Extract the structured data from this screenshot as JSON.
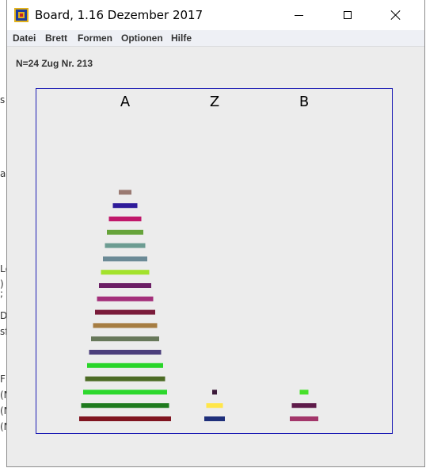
{
  "window": {
    "title": "Board, 1.16 Dezember 2017"
  },
  "menu": [
    "Datei",
    "Brett",
    "Formen",
    "Optionen",
    "Hilfe"
  ],
  "status": "N=24 Zug Nr. 213",
  "board": {
    "pegs": [
      {
        "label": "A",
        "disks": [
          {
            "size": 24,
            "color": "#801520"
          },
          {
            "size": 23,
            "color": "#1e7a1e"
          },
          {
            "size": 22,
            "color": "#2dd82d"
          },
          {
            "size": 21,
            "color": "#4c6b25"
          },
          {
            "size": 20,
            "color": "#29d529"
          },
          {
            "size": 19,
            "color": "#4c3f7c"
          },
          {
            "size": 18,
            "color": "#67785a"
          },
          {
            "size": 17,
            "color": "#a67d42"
          },
          {
            "size": 16,
            "color": "#7a1b3a"
          },
          {
            "size": 15,
            "color": "#a32f7a"
          },
          {
            "size": 14,
            "color": "#6b1e64"
          },
          {
            "size": 13,
            "color": "#a3e22c"
          },
          {
            "size": 12,
            "color": "#6b8a96"
          },
          {
            "size": 11,
            "color": "#6c9c92"
          },
          {
            "size": 10,
            "color": "#66a33a"
          },
          {
            "size": 9,
            "color": "#c0186a"
          },
          {
            "size": 7,
            "color": "#2e1b9a"
          },
          {
            "size": 4,
            "color": "#9a7a72"
          }
        ]
      },
      {
        "label": "Z",
        "disks": [
          {
            "size": 6,
            "color": "#1e2f7a"
          },
          {
            "size": 5,
            "color": "#ffe64a"
          },
          {
            "size": 2,
            "color": "#3c1a3a"
          }
        ]
      },
      {
        "label": "B",
        "disks": [
          {
            "size": 8,
            "color": "#a3366a"
          },
          {
            "size": 7,
            "color": "#5e1b4a"
          },
          {
            "size": 3,
            "color": "#47e02a"
          }
        ]
      }
    ]
  }
}
